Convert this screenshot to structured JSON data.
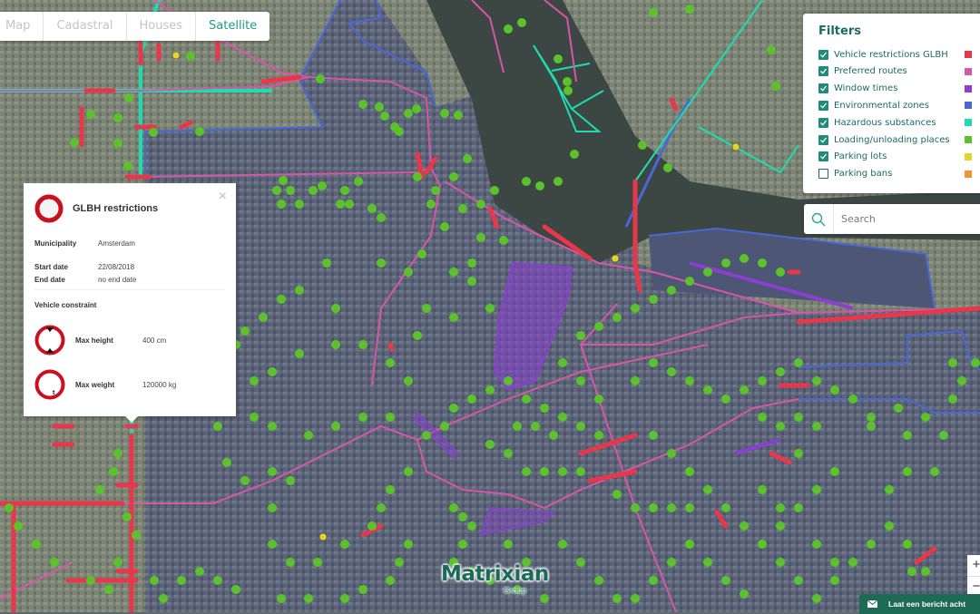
{
  "layer_tabs": [
    {
      "label": "Map",
      "active": false
    },
    {
      "label": "Cadastral",
      "active": false
    },
    {
      "label": "Houses",
      "active": false
    },
    {
      "label": "Satellite",
      "active": true
    }
  ],
  "filters": {
    "title": "Filters",
    "items": [
      {
        "label": "Vehicle restrictions GLBH",
        "checked": true,
        "color": "#e8374b"
      },
      {
        "label": "Preferred routes",
        "checked": true,
        "color": "#d656a8"
      },
      {
        "label": "Window times",
        "checked": true,
        "color": "#8a3fd1"
      },
      {
        "label": "Environmental zones",
        "checked": true,
        "color": "#4a67d6"
      },
      {
        "label": "Hazardous substances",
        "checked": true,
        "color": "#1fdcb0"
      },
      {
        "label": "Loading/unloading places",
        "checked": true,
        "color": "#5cc22c"
      },
      {
        "label": "Parking lots",
        "checked": true,
        "color": "#e3d42c"
      },
      {
        "label": "Parking bans",
        "checked": false,
        "color": "#f5923a"
      }
    ]
  },
  "search": {
    "placeholder": "Search"
  },
  "popup": {
    "title": "GLBH restrictions",
    "municipality_label": "Municipality",
    "municipality": "Amsterdam",
    "start_date_label": "Start date",
    "start_date": "22/08/2018",
    "end_date_label": "End date",
    "end_date": "no end date",
    "constraint_header": "Vehicle constraint",
    "constraints": [
      {
        "label": "Max height",
        "value": "400 cm",
        "icon": "max-height-sign"
      },
      {
        "label": "Max weight",
        "value": "120000 kg",
        "icon": "max-weight-sign"
      }
    ],
    "close": "×"
  },
  "zoom_controls": {
    "in": "+",
    "out": "−"
  },
  "message_bar": {
    "label": "Laat een bericht acht"
  },
  "logo": {
    "name": "Matrixian",
    "sub": "Group"
  },
  "colors": {
    "accent": "#1f9e87",
    "restriction": "#e8374b",
    "preferred_route": "#d656a8",
    "window_time": "#8a3fd1",
    "environmental_zone": "#4a67d6",
    "hazardous": "#1fdcb0",
    "loading": "#5cc22c",
    "parking_lot": "#e3d42c"
  }
}
